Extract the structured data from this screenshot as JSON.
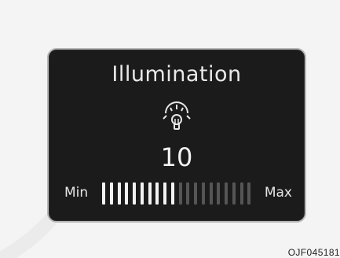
{
  "screen": {
    "title": "Illumination",
    "icon": "dashboard-light-icon",
    "value": "10",
    "min_label": "Min",
    "max_label": "Max",
    "level": 10,
    "level_max": 20
  },
  "caption": {
    "code": "OJF045181"
  },
  "colors": {
    "panel_bg": "#1b1b1b",
    "text": "#e9e9e9",
    "tick_on": "#f2f2f2",
    "tick_off": "#555555"
  }
}
